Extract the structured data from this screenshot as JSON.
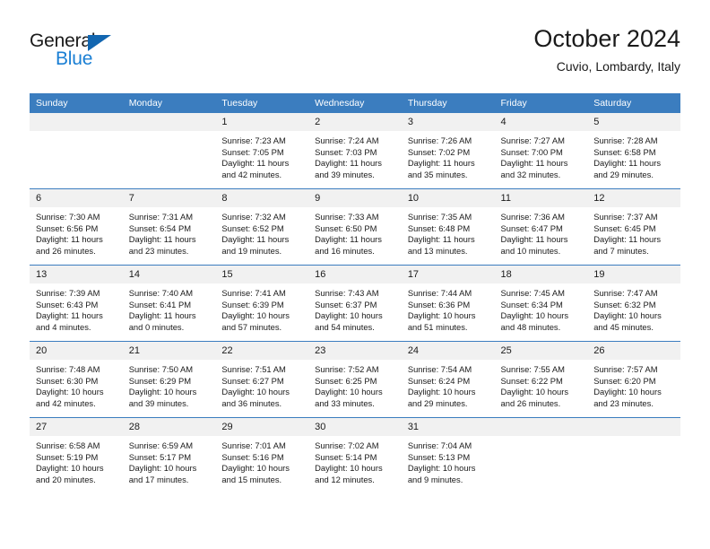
{
  "brand": {
    "name_top": "General",
    "name_bottom": "Blue",
    "triangle_color": "#1266b0",
    "blue_text_color": "#1a7fd4"
  },
  "header": {
    "title": "October 2024",
    "subtitle": "Cuvio, Lombardy, Italy",
    "header_bg_color": "#3b7dbf",
    "daynum_bg_color": "#f1f1f1"
  },
  "weekday_headers": [
    "Sunday",
    "Monday",
    "Tuesday",
    "Wednesday",
    "Thursday",
    "Friday",
    "Saturday"
  ],
  "labels": {
    "sunrise_prefix": "Sunrise:",
    "sunset_prefix": "Sunset:",
    "daylight_prefix": "Daylight:"
  },
  "weeks": [
    [
      {
        "day": "",
        "sunrise": "",
        "sunset": "",
        "daylight": ""
      },
      {
        "day": "",
        "sunrise": "",
        "sunset": "",
        "daylight": ""
      },
      {
        "day": "1",
        "sunrise": "Sunrise: 7:23 AM",
        "sunset": "Sunset: 7:05 PM",
        "daylight": "Daylight: 11 hours and 42 minutes."
      },
      {
        "day": "2",
        "sunrise": "Sunrise: 7:24 AM",
        "sunset": "Sunset: 7:03 PM",
        "daylight": "Daylight: 11 hours and 39 minutes."
      },
      {
        "day": "3",
        "sunrise": "Sunrise: 7:26 AM",
        "sunset": "Sunset: 7:02 PM",
        "daylight": "Daylight: 11 hours and 35 minutes."
      },
      {
        "day": "4",
        "sunrise": "Sunrise: 7:27 AM",
        "sunset": "Sunset: 7:00 PM",
        "daylight": "Daylight: 11 hours and 32 minutes."
      },
      {
        "day": "5",
        "sunrise": "Sunrise: 7:28 AM",
        "sunset": "Sunset: 6:58 PM",
        "daylight": "Daylight: 11 hours and 29 minutes."
      }
    ],
    [
      {
        "day": "6",
        "sunrise": "Sunrise: 7:30 AM",
        "sunset": "Sunset: 6:56 PM",
        "daylight": "Daylight: 11 hours and 26 minutes."
      },
      {
        "day": "7",
        "sunrise": "Sunrise: 7:31 AM",
        "sunset": "Sunset: 6:54 PM",
        "daylight": "Daylight: 11 hours and 23 minutes."
      },
      {
        "day": "8",
        "sunrise": "Sunrise: 7:32 AM",
        "sunset": "Sunset: 6:52 PM",
        "daylight": "Daylight: 11 hours and 19 minutes."
      },
      {
        "day": "9",
        "sunrise": "Sunrise: 7:33 AM",
        "sunset": "Sunset: 6:50 PM",
        "daylight": "Daylight: 11 hours and 16 minutes."
      },
      {
        "day": "10",
        "sunrise": "Sunrise: 7:35 AM",
        "sunset": "Sunset: 6:48 PM",
        "daylight": "Daylight: 11 hours and 13 minutes."
      },
      {
        "day": "11",
        "sunrise": "Sunrise: 7:36 AM",
        "sunset": "Sunset: 6:47 PM",
        "daylight": "Daylight: 11 hours and 10 minutes."
      },
      {
        "day": "12",
        "sunrise": "Sunrise: 7:37 AM",
        "sunset": "Sunset: 6:45 PM",
        "daylight": "Daylight: 11 hours and 7 minutes."
      }
    ],
    [
      {
        "day": "13",
        "sunrise": "Sunrise: 7:39 AM",
        "sunset": "Sunset: 6:43 PM",
        "daylight": "Daylight: 11 hours and 4 minutes."
      },
      {
        "day": "14",
        "sunrise": "Sunrise: 7:40 AM",
        "sunset": "Sunset: 6:41 PM",
        "daylight": "Daylight: 11 hours and 0 minutes."
      },
      {
        "day": "15",
        "sunrise": "Sunrise: 7:41 AM",
        "sunset": "Sunset: 6:39 PM",
        "daylight": "Daylight: 10 hours and 57 minutes."
      },
      {
        "day": "16",
        "sunrise": "Sunrise: 7:43 AM",
        "sunset": "Sunset: 6:37 PM",
        "daylight": "Daylight: 10 hours and 54 minutes."
      },
      {
        "day": "17",
        "sunrise": "Sunrise: 7:44 AM",
        "sunset": "Sunset: 6:36 PM",
        "daylight": "Daylight: 10 hours and 51 minutes."
      },
      {
        "day": "18",
        "sunrise": "Sunrise: 7:45 AM",
        "sunset": "Sunset: 6:34 PM",
        "daylight": "Daylight: 10 hours and 48 minutes."
      },
      {
        "day": "19",
        "sunrise": "Sunrise: 7:47 AM",
        "sunset": "Sunset: 6:32 PM",
        "daylight": "Daylight: 10 hours and 45 minutes."
      }
    ],
    [
      {
        "day": "20",
        "sunrise": "Sunrise: 7:48 AM",
        "sunset": "Sunset: 6:30 PM",
        "daylight": "Daylight: 10 hours and 42 minutes."
      },
      {
        "day": "21",
        "sunrise": "Sunrise: 7:50 AM",
        "sunset": "Sunset: 6:29 PM",
        "daylight": "Daylight: 10 hours and 39 minutes."
      },
      {
        "day": "22",
        "sunrise": "Sunrise: 7:51 AM",
        "sunset": "Sunset: 6:27 PM",
        "daylight": "Daylight: 10 hours and 36 minutes."
      },
      {
        "day": "23",
        "sunrise": "Sunrise: 7:52 AM",
        "sunset": "Sunset: 6:25 PM",
        "daylight": "Daylight: 10 hours and 33 minutes."
      },
      {
        "day": "24",
        "sunrise": "Sunrise: 7:54 AM",
        "sunset": "Sunset: 6:24 PM",
        "daylight": "Daylight: 10 hours and 29 minutes."
      },
      {
        "day": "25",
        "sunrise": "Sunrise: 7:55 AM",
        "sunset": "Sunset: 6:22 PM",
        "daylight": "Daylight: 10 hours and 26 minutes."
      },
      {
        "day": "26",
        "sunrise": "Sunrise: 7:57 AM",
        "sunset": "Sunset: 6:20 PM",
        "daylight": "Daylight: 10 hours and 23 minutes."
      }
    ],
    [
      {
        "day": "27",
        "sunrise": "Sunrise: 6:58 AM",
        "sunset": "Sunset: 5:19 PM",
        "daylight": "Daylight: 10 hours and 20 minutes."
      },
      {
        "day": "28",
        "sunrise": "Sunrise: 6:59 AM",
        "sunset": "Sunset: 5:17 PM",
        "daylight": "Daylight: 10 hours and 17 minutes."
      },
      {
        "day": "29",
        "sunrise": "Sunrise: 7:01 AM",
        "sunset": "Sunset: 5:16 PM",
        "daylight": "Daylight: 10 hours and 15 minutes."
      },
      {
        "day": "30",
        "sunrise": "Sunrise: 7:02 AM",
        "sunset": "Sunset: 5:14 PM",
        "daylight": "Daylight: 10 hours and 12 minutes."
      },
      {
        "day": "31",
        "sunrise": "Sunrise: 7:04 AM",
        "sunset": "Sunset: 5:13 PM",
        "daylight": "Daylight: 10 hours and 9 minutes."
      },
      {
        "day": "",
        "sunrise": "",
        "sunset": "",
        "daylight": ""
      },
      {
        "day": "",
        "sunrise": "",
        "sunset": "",
        "daylight": ""
      }
    ]
  ]
}
